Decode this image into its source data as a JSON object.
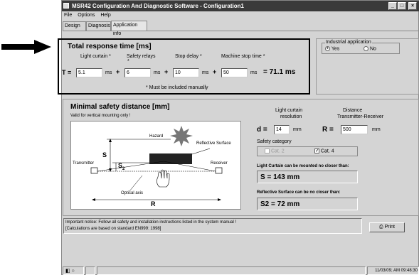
{
  "window": {
    "title": "MSR42 Configuration And Diagnostic Software - Configuration1",
    "min_btn": "_",
    "max_btn": "□",
    "close_btn": "×"
  },
  "menu": [
    "File",
    "Options",
    "Help"
  ],
  "tabs": [
    "Design",
    "Diagnosis",
    "Application info"
  ],
  "response": {
    "title": "Total response time [ms]",
    "col_light_curtain": "Light curtain *",
    "col_safety_relays": "Safety relays",
    "col_safety_relays_mark": "*",
    "col_stop_delay": "Stop delay *",
    "col_machine_stop": "Machine stop time *",
    "t_label": "T =",
    "light_curtain_value": "5.1",
    "safety_relays_value": "6",
    "stop_delay_value": "10",
    "machine_stop_value": "50",
    "unit": "ms",
    "plus": "+",
    "total": "= 71.1 ms",
    "note": "* Must be included manually"
  },
  "industrial": {
    "label": "Industrial application",
    "yes": "Yes",
    "no": "No",
    "selected": "Yes"
  },
  "safety_distance": {
    "title": "Minimal safety distance [mm]",
    "subtitle": "Valid for vertical mounting only !",
    "diagram": {
      "hazard": "Hazard",
      "reflective_surface": "Reflective Surface",
      "transmitter": "Transmitter",
      "receiver": "Receiver",
      "optical_axis": "Optical axis",
      "s": "S",
      "s2": "S",
      "s2_sub": "2",
      "r": "R"
    },
    "resolution_label_1": "Light curtain",
    "resolution_label_2": "resolution",
    "distance_label_1": "Distance",
    "distance_label_2": "Transmitter-Receiver",
    "d_label": "d =",
    "d_value": "14",
    "d_unit": "mm",
    "r_label": "R =",
    "r_value": "500",
    "r_unit": "mm",
    "safety_category": "Safety category",
    "cat2": "Cat. 2",
    "cat4": "Cat. 4",
    "cat4_checked": "✓",
    "result_s_label": "Light Curtain can be mounted no closer than:",
    "result_s": "S = 143 mm",
    "result_s2_label": "Reflective Surface can be no closer than:",
    "result_s2": "S2 = 72 mm"
  },
  "notice": {
    "line1": "Important notice: Follow all safety and installation instructions listed in the system manual !",
    "line2": "[Calculations are based on standard EN999: 1998]"
  },
  "print_button": "Print",
  "status_bar": {
    "timestamp": "11/03/09; AM 09:48:30"
  },
  "colors": {
    "titlebar": "#3a3a3a",
    "window_bg": "#d4d4d4",
    "arrow": "#000000"
  }
}
